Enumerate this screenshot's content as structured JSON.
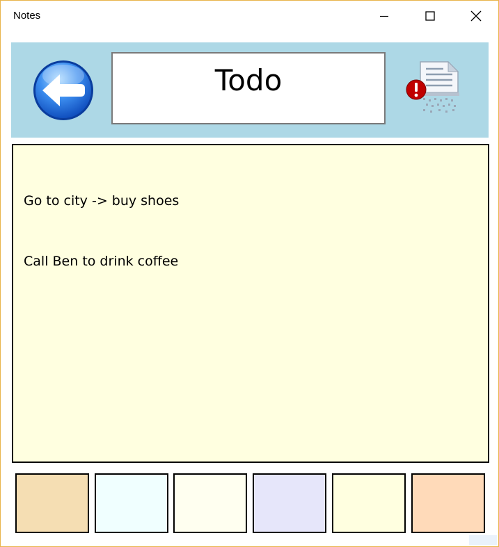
{
  "window": {
    "title": "Notes"
  },
  "note": {
    "title": "Todo",
    "lines": [
      "Go to city -> buy shoes",
      "Call Ben to drink coffee"
    ]
  },
  "icons": {
    "back": "back-arrow-icon",
    "delete": "shred-document-icon"
  },
  "colors": {
    "header_background": "#add8e6",
    "note_background": "#ffffe0",
    "window_border": "#e8b44a"
  },
  "swatches": [
    {
      "name": "wheat",
      "color": "#f5deb3"
    },
    {
      "name": "azure",
      "color": "#f0ffff"
    },
    {
      "name": "ivory",
      "color": "#fffff0"
    },
    {
      "name": "lavender",
      "color": "#e6e6fa"
    },
    {
      "name": "light-yellow",
      "color": "#ffffe0"
    },
    {
      "name": "peach-puff",
      "color": "#ffdab9"
    }
  ]
}
